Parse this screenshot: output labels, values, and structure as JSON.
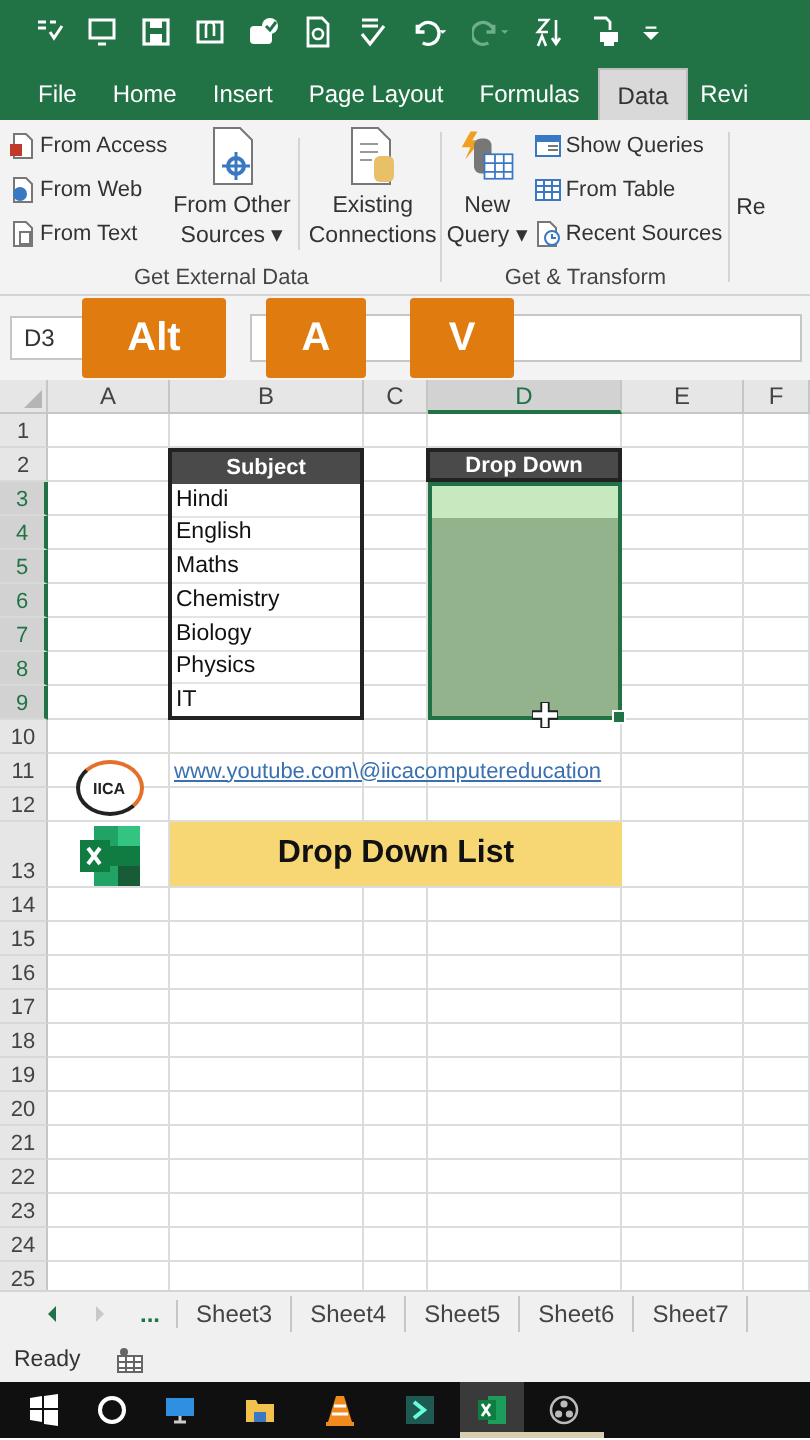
{
  "ribbon_tabs": [
    {
      "label": "File",
      "selected": false
    },
    {
      "label": "Home",
      "selected": false
    },
    {
      "label": "Insert",
      "selected": false
    },
    {
      "label": "Page Layout",
      "selected": false
    },
    {
      "label": "Formulas",
      "selected": false
    },
    {
      "label": "Data",
      "selected": true
    },
    {
      "label": "Revi",
      "selected": false
    }
  ],
  "ribbon": {
    "from_access": "From Access",
    "from_web": "From Web",
    "from_text": "From Text",
    "from_other_sources": [
      "From Other",
      "Sources ▾"
    ],
    "existing_connections": [
      "Existing",
      "Connections"
    ],
    "get_external_data": "Get External Data",
    "new_query": [
      "New",
      "Query ▾"
    ],
    "show_queries": "Show Queries",
    "from_table": "From Table",
    "recent_sources": "Recent Sources",
    "get_transform": "Get & Transform",
    "cut_off_button": "Re"
  },
  "key_tips": [
    "Alt",
    "A",
    "V"
  ],
  "name_box": "D3",
  "columns": [
    {
      "label": "A",
      "selected": false
    },
    {
      "label": "B",
      "selected": false
    },
    {
      "label": "C",
      "selected": false
    },
    {
      "label": "D",
      "selected": true
    },
    {
      "label": "E",
      "selected": false
    },
    {
      "label": "F",
      "selected": false
    }
  ],
  "rows": [
    {
      "number": "1",
      "selected": false,
      "kind": "normal"
    },
    {
      "number": "2",
      "selected": false,
      "kind": "normal"
    },
    {
      "number": "3",
      "selected": true,
      "kind": "normal"
    },
    {
      "number": "4",
      "selected": true,
      "kind": "normal"
    },
    {
      "number": "5",
      "selected": true,
      "kind": "normal"
    },
    {
      "number": "6",
      "selected": true,
      "kind": "normal"
    },
    {
      "number": "7",
      "selected": true,
      "kind": "normal"
    },
    {
      "number": "8",
      "selected": true,
      "kind": "normal"
    },
    {
      "number": "9",
      "selected": true,
      "kind": "normal"
    },
    {
      "number": "10",
      "selected": false,
      "kind": "normal"
    },
    {
      "number": "11",
      "selected": false,
      "kind": "normal"
    },
    {
      "number": "12",
      "selected": false,
      "kind": "normal"
    },
    {
      "number": "13",
      "selected": false,
      "kind": "tall"
    },
    {
      "number": "14",
      "selected": false,
      "kind": "normal"
    },
    {
      "number": "15",
      "selected": false,
      "kind": "normal"
    },
    {
      "number": "16",
      "selected": false,
      "kind": "normal"
    },
    {
      "number": "17",
      "selected": false,
      "kind": "normal"
    },
    {
      "number": "18",
      "selected": false,
      "kind": "normal"
    },
    {
      "number": "19",
      "selected": false,
      "kind": "normal"
    },
    {
      "number": "20",
      "selected": false,
      "kind": "normal"
    },
    {
      "number": "21",
      "selected": false,
      "kind": "normal"
    },
    {
      "number": "22",
      "selected": false,
      "kind": "normal"
    },
    {
      "number": "23",
      "selected": false,
      "kind": "normal"
    },
    {
      "number": "24",
      "selected": false,
      "kind": "normal"
    },
    {
      "number": "25",
      "selected": false,
      "kind": "normal"
    }
  ],
  "subject_table": {
    "header": "Subject",
    "items": [
      "Hindi",
      "English",
      "Maths",
      "Chemistry",
      "Biology",
      "Physics",
      "IT"
    ]
  },
  "dropdown_table": {
    "header": "Drop Down",
    "cells": [
      {
        "active": true
      },
      {
        "active": false
      },
      {
        "active": false
      },
      {
        "active": false
      },
      {
        "active": false
      },
      {
        "active": false
      },
      {
        "active": false
      }
    ]
  },
  "logo_text": "IICA",
  "link": "www.youtube.com\\@iicacomputereducation",
  "banner": "Drop Down List",
  "sheet_nav": "...",
  "sheet_tabs": [
    "Sheet3",
    "Sheet4",
    "Sheet5",
    "Sheet6",
    "Sheet7"
  ],
  "status": "Ready",
  "taskbar": [
    {
      "kind": "start",
      "running": false,
      "active": false
    },
    {
      "kind": "search",
      "running": false,
      "active": false
    },
    {
      "kind": "monitor",
      "running": false,
      "active": false
    },
    {
      "kind": "folder",
      "running": false,
      "active": false
    },
    {
      "kind": "cone",
      "running": false,
      "active": false
    },
    {
      "kind": "arrow",
      "running": false,
      "active": false
    },
    {
      "kind": "excel",
      "running": true,
      "active": true
    },
    {
      "kind": "recorder",
      "running": true,
      "active": false
    }
  ]
}
